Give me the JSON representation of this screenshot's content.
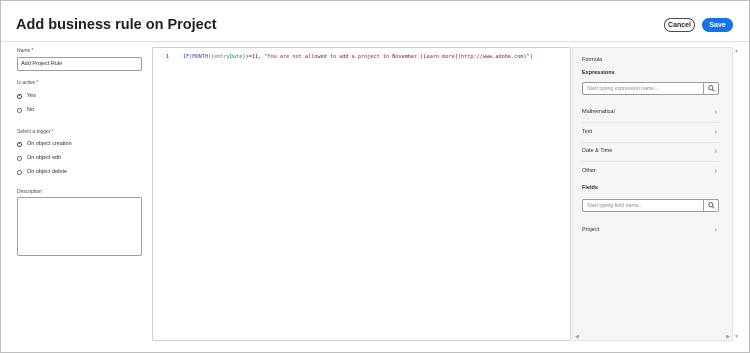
{
  "header": {
    "title": "Add business rule on Project",
    "cancel_label": "Cancel",
    "save_label": "Save"
  },
  "form": {
    "name_label": "Name",
    "required_mark": "*",
    "name_value": "Add Project Rule",
    "is_active_label": "Is active",
    "is_active_options": [
      {
        "label": "Yes",
        "selected": true
      },
      {
        "label": "No",
        "selected": false
      }
    ],
    "trigger_label": "Select a trigger",
    "trigger_options": [
      {
        "label": "On object creation",
        "selected": true
      },
      {
        "label": "On object edit",
        "selected": false
      },
      {
        "label": "On object delete",
        "selected": false
      }
    ],
    "description_label": "Description",
    "description_value": ""
  },
  "editor": {
    "line_number": "1",
    "tokens": {
      "fn_if": "IF(",
      "fn_month": "MONTH(",
      "field": "{entryDate}",
      "rest": ")=11, ",
      "message": "\"You are not allowed to add a project in November.[Learn more](http://www.adobe.com)\"",
      "close": ")"
    }
  },
  "panel": {
    "title": "Formula",
    "expressions_label": "Expressions",
    "expression_search_placeholder": "Start typing expression name...",
    "expression_categories": [
      "Mathematical",
      "Text",
      "Date & Time",
      "Other"
    ],
    "fields_label": "Fields",
    "field_search_placeholder": "Start typing field name...",
    "field_categories": [
      "Project"
    ]
  },
  "icons": {
    "search": "search-icon",
    "chevron": "chevron-right-icon"
  },
  "colors": {
    "accent": "#1473e6",
    "code_function": "#2e4fb3",
    "code_field": "#29837a",
    "code_string": "#a31515"
  }
}
